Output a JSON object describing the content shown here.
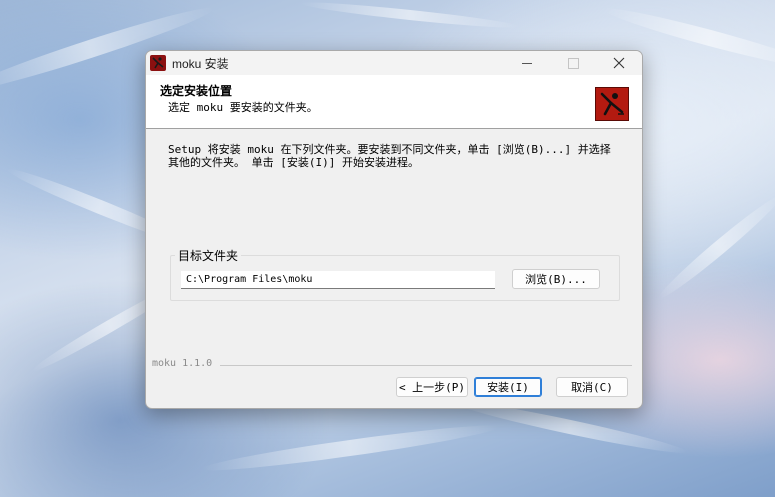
{
  "window": {
    "title": "moku 安装"
  },
  "header": {
    "title": "选定安装位置",
    "subtitle": "选定 moku 要安装的文件夹。"
  },
  "body": {
    "instructions": "Setup 将安装 moku 在下列文件夹。要安装到不同文件夹，单击 [浏览(B)...] 并选择其他的文件夹。 单击 [安装(I)] 开始安装进程。"
  },
  "destination": {
    "group_label": "目标文件夹",
    "path_value": "C:\\Program Files\\moku",
    "browse_label": "浏览(B)..."
  },
  "footer": {
    "version": "moku 1.1.0",
    "back_label": "< 上一步(P)",
    "install_label": "安装(I)",
    "cancel_label": "取消(C)"
  },
  "icons": {
    "app": "moku-app-icon",
    "header_logo": "moku-logo-icon",
    "minimize": "minimize-icon",
    "maximize": "maximize-icon",
    "close": "close-icon"
  },
  "colors": {
    "accent": "#2f7fd8",
    "logo": "#b31a10"
  }
}
